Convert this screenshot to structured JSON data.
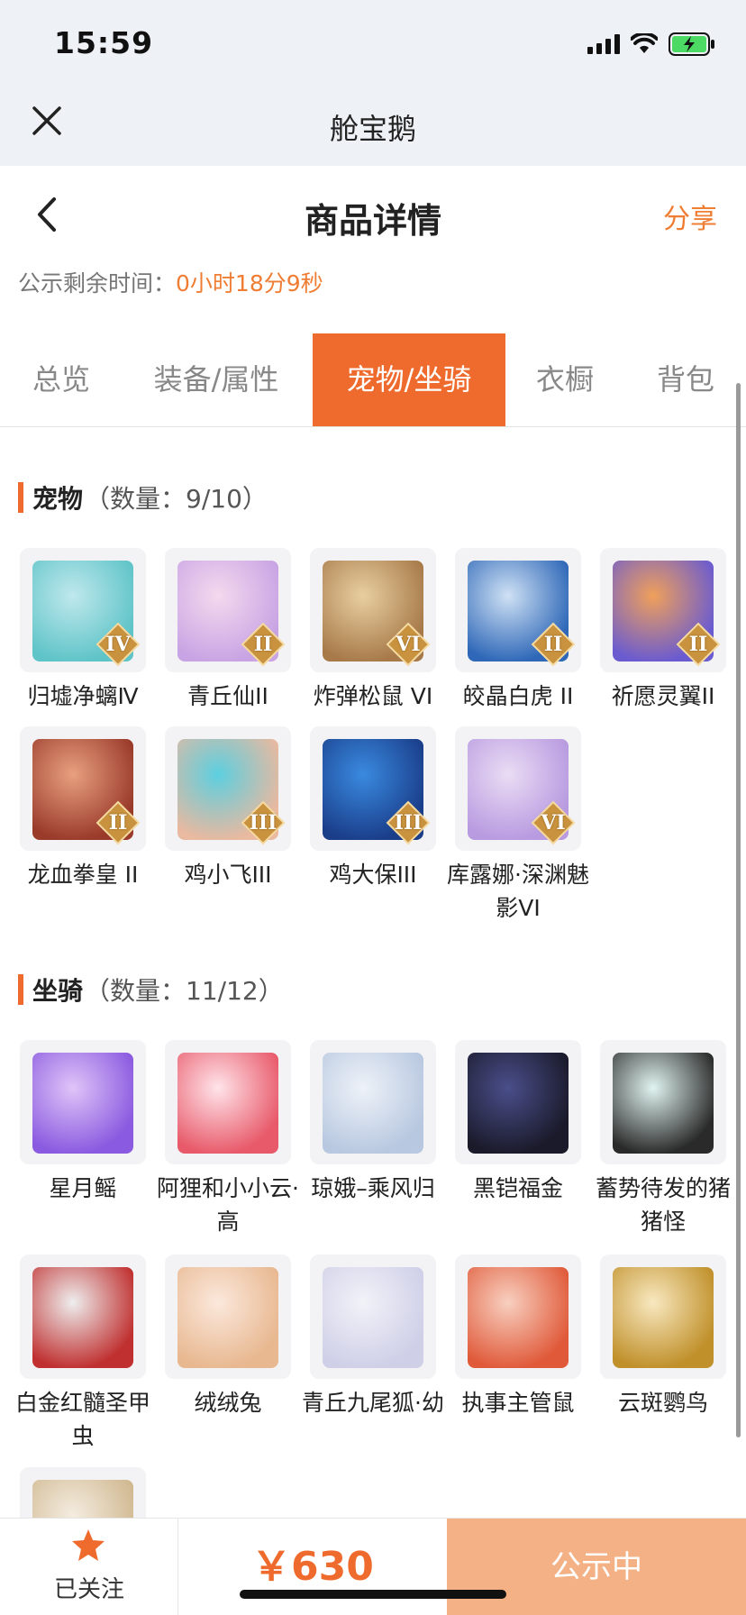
{
  "status_bar": {
    "time": "15:59",
    "icons": [
      "signal-icon",
      "wifi-icon",
      "battery-charging-icon"
    ],
    "battery_color": "#4cd964"
  },
  "app": {
    "title": "舱宝鹅"
  },
  "header": {
    "title": "商品详情",
    "share_label": "分享"
  },
  "countdown": {
    "label": "公示剩余时间：",
    "value": "0小时18分9秒"
  },
  "tabs": [
    {
      "label": "总览",
      "active": false
    },
    {
      "label": "装备/属性",
      "active": false
    },
    {
      "label": "宠物/坐骑",
      "active": true
    },
    {
      "label": "衣橱",
      "active": false
    },
    {
      "label": "背包",
      "active": false
    }
  ],
  "pets": {
    "title": "宠物",
    "count": "（数量：9/10）",
    "items": [
      {
        "name": "归墟净螭Ⅳ",
        "rank": "IV",
        "colors": [
          "#bfe8ec",
          "#5fc4c8"
        ]
      },
      {
        "name": "青丘仙II",
        "rank": "II",
        "colors": [
          "#f4d9ee",
          "#c9a4e4"
        ]
      },
      {
        "name": "炸弹松鼠 VI",
        "rank": "VI",
        "colors": [
          "#e8cfa0",
          "#a87a4a"
        ]
      },
      {
        "name": "皎晶白虎 II",
        "rank": "II",
        "colors": [
          "#cfe1f4",
          "#2f68b8"
        ]
      },
      {
        "name": "祈愿灵翼II",
        "rank": "II",
        "colors": [
          "#f0a05a",
          "#6a5bd0"
        ]
      },
      {
        "name": "龙血拳皇 II",
        "rank": "II",
        "colors": [
          "#e8a080",
          "#9a3a2a"
        ]
      },
      {
        "name": "鸡小飞III",
        "rank": "III",
        "colors": [
          "#5ccfe0",
          "#e9b9a0"
        ]
      },
      {
        "name": "鸡大保III",
        "rank": "III",
        "colors": [
          "#3a8ae0",
          "#1a3e8a"
        ]
      },
      {
        "name": "库露娜·深渊魅影VI",
        "rank": "VI",
        "colors": [
          "#eadcf4",
          "#b89ae0"
        ]
      }
    ]
  },
  "mounts": {
    "title": "坐骑",
    "count": "（数量：11/12）",
    "items": [
      {
        "name": "星月鳐",
        "colors": [
          "#e0c4f8",
          "#8a5ae0"
        ]
      },
      {
        "name": "阿狸和小小云·高",
        "colors": [
          "#ffe4ea",
          "#e85a6a"
        ]
      },
      {
        "name": "琼娥–乘风归",
        "colors": [
          "#eef2f8",
          "#b8c8e0"
        ]
      },
      {
        "name": "黑铠福金",
        "colors": [
          "#4a4e8a",
          "#1a1a2a"
        ]
      },
      {
        "name": "蓄势待发的猪猪怪",
        "colors": [
          "#e0f4f0",
          "#2a2a2a"
        ]
      },
      {
        "name": "白金红髓圣甲虫",
        "colors": [
          "#eeeeee",
          "#c03030"
        ]
      },
      {
        "name": "绒绒兔",
        "colors": [
          "#fbe8dc",
          "#e8b890"
        ]
      },
      {
        "name": "青丘九尾狐·幼",
        "colors": [
          "#f2f2f8",
          "#cfcfe8"
        ]
      },
      {
        "name": "执事主管鼠",
        "colors": [
          "#f8d0c0",
          "#e05a3a"
        ]
      },
      {
        "name": "云斑鹦鸟",
        "colors": [
          "#f8e8c0",
          "#c0902a"
        ]
      },
      {
        "name": "",
        "colors": [
          "#f4ece0",
          "#d0b890"
        ]
      }
    ]
  },
  "bottom_bar": {
    "follow_label": "已关注",
    "price": "￥630",
    "action_label": "公示中"
  },
  "colors": {
    "accent": "#ef6b2d",
    "accent_light": "#f3b185",
    "rank_badge": "#c8923e"
  }
}
